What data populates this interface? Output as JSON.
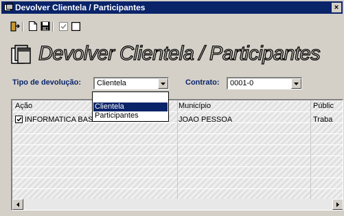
{
  "window": {
    "title": "Devolver Clientela / Participantes",
    "close": "×"
  },
  "toolbar": {
    "icons": [
      "exit-icon",
      "new-document-icon",
      "save-icon",
      "check-icon",
      "blank-box-icon"
    ]
  },
  "heading": {
    "text": "Devolver Clientela / Participantes"
  },
  "form": {
    "tipo_label": "Tipo de devolução:",
    "tipo_value": "Clientela",
    "contrato_label": "Contrato:",
    "contrato_value": "0001-0"
  },
  "dropdown": {
    "options": [
      "Clientela",
      "Participantes"
    ],
    "selected": "Clientela"
  },
  "grid": {
    "columns": [
      "Ação",
      "Município",
      "Públic"
    ],
    "rows": [
      {
        "checked": true,
        "acao": "INFORMATICA BASICA",
        "municipio": "JOAO PESSOA",
        "publico": "Traba"
      }
    ]
  }
}
